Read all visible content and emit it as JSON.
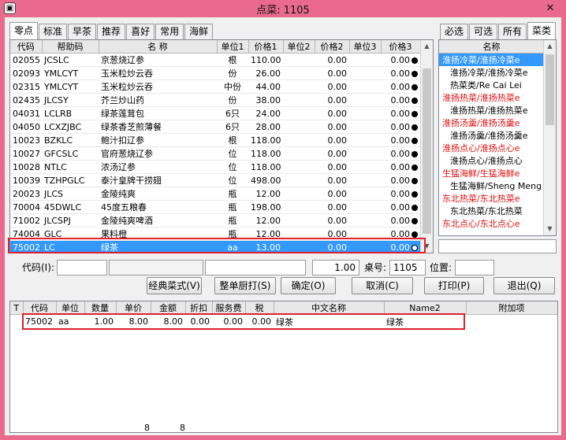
{
  "window": {
    "title": "点菜: 1105",
    "icon": "app-icon"
  },
  "dish_tabs": [
    "零点",
    "标准",
    "早茶",
    "推荐",
    "喜好",
    "常用",
    "海鲜"
  ],
  "dish_grid": {
    "columns": [
      "代码",
      "帮助码",
      "名   称",
      "单位1",
      "价格1",
      "单位2",
      "价格2",
      "单位3",
      "价格3"
    ],
    "rows": [
      {
        "code": "02055",
        "help": "JCSLC",
        "name": "京葱烧辽参",
        "unit1": "根",
        "price1": "110.00",
        "unit2": "",
        "price2": "0.00",
        "unit3": "",
        "price3": "0.00"
      },
      {
        "code": "02093",
        "help": "YMLCYT",
        "name": "玉米粒炒云吞",
        "unit1": "份",
        "price1": "26.00",
        "unit2": "",
        "price2": "0.00",
        "unit3": "",
        "price3": "0.00"
      },
      {
        "code": "02315",
        "help": "YMLCYT",
        "name": "玉米粒炒云吞",
        "unit1": "中份",
        "price1": "44.00",
        "unit2": "",
        "price2": "0.00",
        "unit3": "",
        "price3": "0.00"
      },
      {
        "code": "02435",
        "help": "JLCSY",
        "name": "芥兰炒山药",
        "unit1": "份",
        "price1": "38.00",
        "unit2": "",
        "price2": "0.00",
        "unit3": "",
        "price3": "0.00"
      },
      {
        "code": "04031",
        "help": "LCLRB",
        "name": "绿茶莲茸包",
        "unit1": "6只",
        "price1": "24.00",
        "unit2": "",
        "price2": "0.00",
        "unit3": "",
        "price3": "0.00"
      },
      {
        "code": "04050",
        "help": "LCXZJBC",
        "name": "绿茶香芝煎薄餐",
        "unit1": "6只",
        "price1": "28.00",
        "unit2": "",
        "price2": "0.00",
        "unit3": "",
        "price3": "0.00"
      },
      {
        "code": "10023",
        "help": "BZKLC",
        "name": "鲍汁扣辽参",
        "unit1": "根",
        "price1": "118.00",
        "unit2": "",
        "price2": "0.00",
        "unit3": "",
        "price3": "0.00"
      },
      {
        "code": "10027",
        "help": "GFCSLC",
        "name": "官府葱烧辽参",
        "unit1": "位",
        "price1": "118.00",
        "unit2": "",
        "price2": "0.00",
        "unit3": "",
        "price3": "0.00"
      },
      {
        "code": "10028",
        "help": "NTLC",
        "name": "浓汤辽参",
        "unit1": "位",
        "price1": "118.00",
        "unit2": "",
        "price2": "0.00",
        "unit3": "",
        "price3": "0.00"
      },
      {
        "code": "10039",
        "help": "TZHPGLC",
        "name": "泰汁皇牌干捞翅",
        "unit1": "位",
        "price1": "498.00",
        "unit2": "",
        "price2": "0.00",
        "unit3": "",
        "price3": "0.00"
      },
      {
        "code": "20023",
        "help": "JLCS",
        "name": "金陵纯爽",
        "unit1": "瓶",
        "price1": "12.00",
        "unit2": "",
        "price2": "0.00",
        "unit3": "",
        "price3": "0.00"
      },
      {
        "code": "70004",
        "help": "45DWLC",
        "name": "45度五粮春",
        "unit1": "瓶",
        "price1": "198.00",
        "unit2": "",
        "price2": "0.00",
        "unit3": "",
        "price3": "0.00"
      },
      {
        "code": "71002",
        "help": "JLCSPJ",
        "name": "金陵纯爽啤酒",
        "unit1": "瓶",
        "price1": "12.00",
        "unit2": "",
        "price2": "0.00",
        "unit3": "",
        "price3": "0.00"
      },
      {
        "code": "74004",
        "help": "GLC",
        "name": "果料橙",
        "unit1": "瓶",
        "price1": "12.00",
        "unit2": "",
        "price2": "0.00",
        "unit3": "",
        "price3": "0.00"
      },
      {
        "code": "75002",
        "help": "LC",
        "name": "绿茶",
        "unit1": "aa",
        "price1": "13.00",
        "unit2": "",
        "price2": "0.00",
        "unit3": "",
        "price3": "0.00"
      }
    ]
  },
  "category_tabs": [
    "必选",
    "可选",
    "所有",
    "菜类"
  ],
  "category_panel": {
    "header": "名称",
    "items": [
      {
        "label": "淮扬冷菜/淮扬冷菜e",
        "style": "selected"
      },
      {
        "label": "淮扬冷菜/淮扬冷菜e",
        "style": "indent"
      },
      {
        "label": "热菜类/Re Cai Lei",
        "style": "indent"
      },
      {
        "label": "淮扬热菜/淮扬热菜e",
        "style": "red"
      },
      {
        "label": "淮扬热菜/淮扬热菜e",
        "style": "indent"
      },
      {
        "label": "淮扬汤羹/淮扬汤羹e",
        "style": "red"
      },
      {
        "label": "淮扬汤羹/淮扬汤羹e",
        "style": "indent"
      },
      {
        "label": "淮扬点心/淮扬点心e",
        "style": "red"
      },
      {
        "label": "淮扬点心/淮扬点心",
        "style": "indent"
      },
      {
        "label": "生猛海鲜/生猛海鲜e",
        "style": "red"
      },
      {
        "label": "生猛海鲜/Sheng Meng H",
        "style": "indent"
      },
      {
        "label": "东北热菜/东北热菜e",
        "style": "red"
      },
      {
        "label": "东北热菜/东北热菜",
        "style": "indent"
      },
      {
        "label": "东北点心/东北点心e",
        "style": "red"
      }
    ]
  },
  "form": {
    "code_label": "代码(I):",
    "qty_value": "1.00",
    "table_label": "桌号:",
    "table_value": "1105",
    "position_label": "位置:"
  },
  "buttons": {
    "classic": "经典菜式(V)",
    "print_kitchen": "整单厨打(S)",
    "ok": "确定(O)",
    "cancel": "取消(C)",
    "print": "打印(P)",
    "exit": "退出(Q)"
  },
  "order_grid": {
    "columns": [
      "T",
      "代码",
      "单位",
      "数量",
      "单价",
      "金额",
      "折扣",
      "服务费",
      "税",
      "中文名称",
      "Name2",
      "附加项"
    ],
    "rows": [
      {
        "t": "",
        "code": "75002",
        "unit": "aa",
        "qty": "1.00",
        "price": "8.00",
        "amount": "8.00",
        "discount": "0.00",
        "service": "0.00",
        "tax": "0.00",
        "cn_name": "绿茶",
        "name2": "绿茶",
        "extra": ""
      }
    ],
    "totals": {
      "price": "8",
      "amount": "8"
    }
  }
}
